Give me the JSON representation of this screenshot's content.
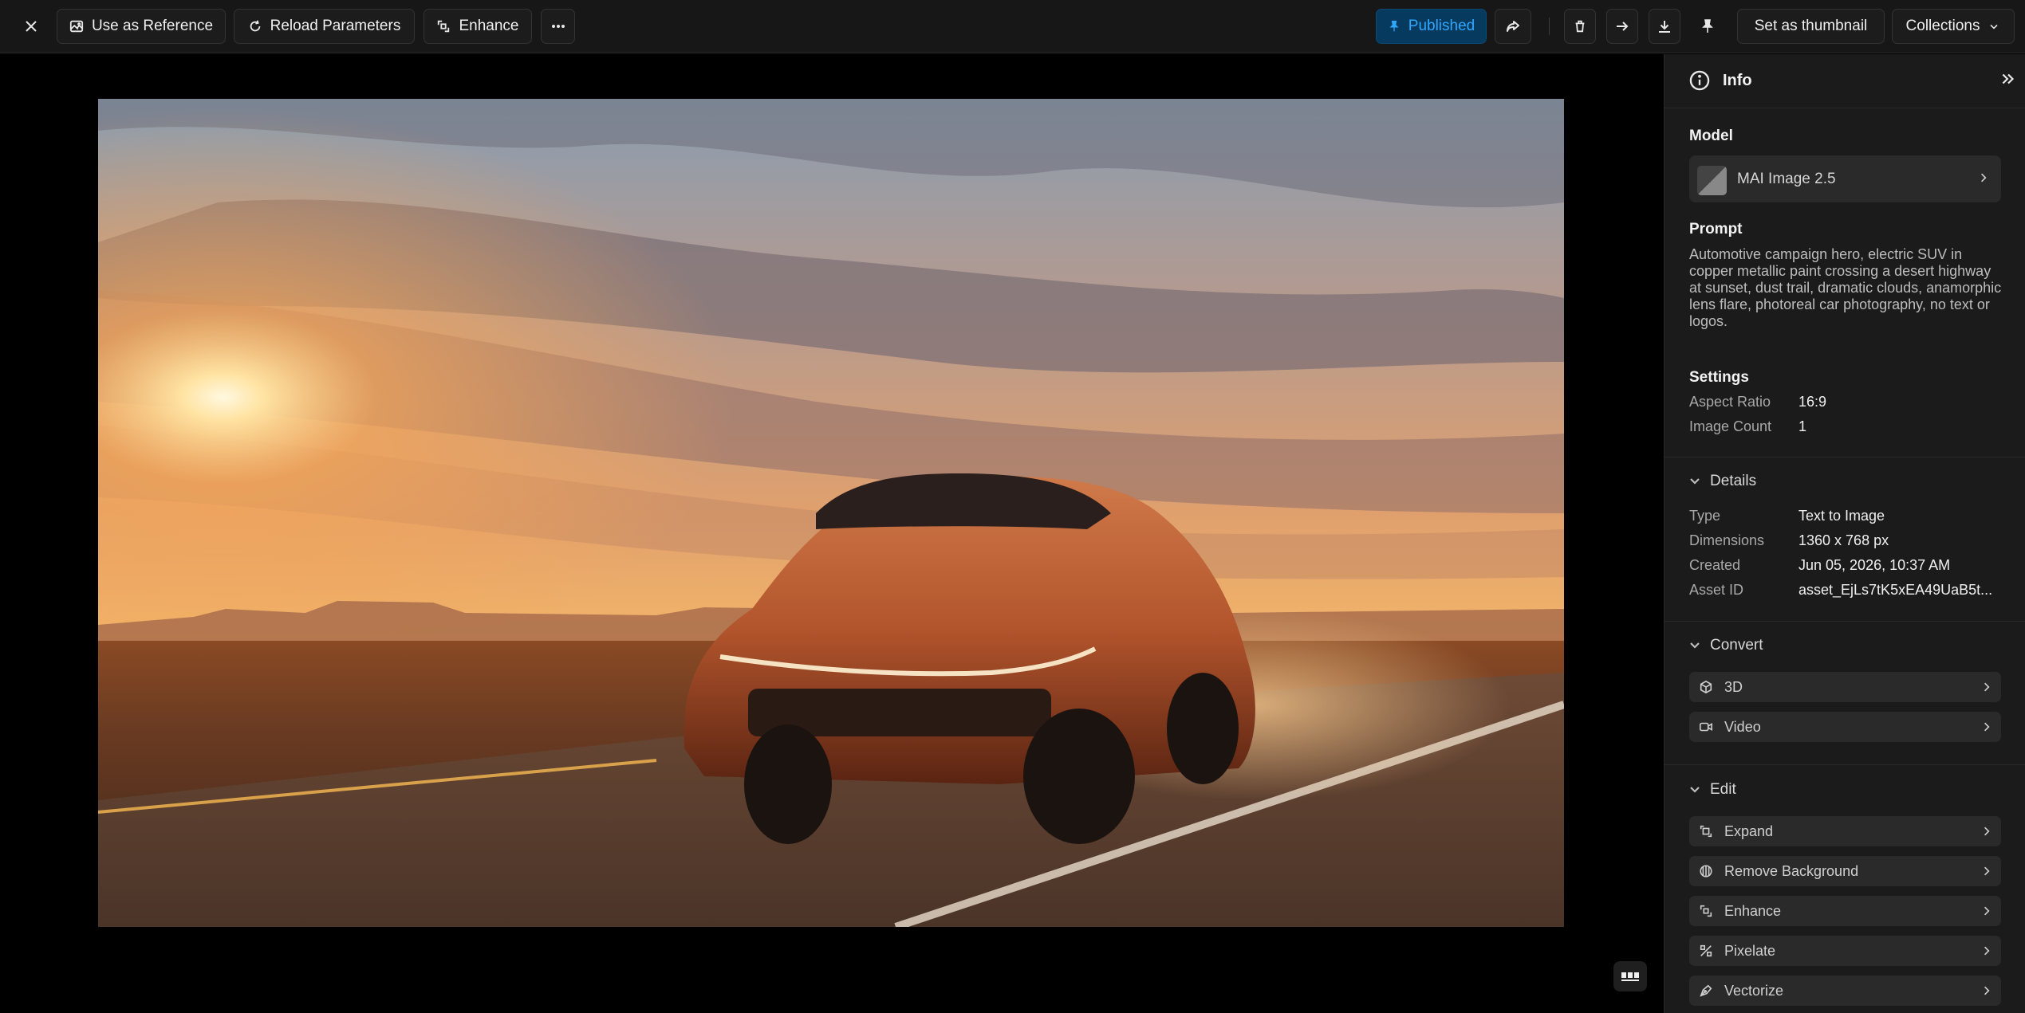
{
  "toolbar": {
    "close_icon": "close-icon",
    "use_as_reference": "Use as Reference",
    "reload_parameters": "Reload Parameters",
    "enhance": "Enhance",
    "more_icon": "more-horizontal-icon",
    "published": "Published",
    "set_as_thumbnail": "Set as thumbnail",
    "collections": "Collections"
  },
  "sidebar": {
    "title": "Info",
    "model_label": "Model",
    "model_name": "MAI Image 2.5",
    "prompt_label": "Prompt",
    "prompt_text": "Automotive campaign hero, electric SUV in copper metallic paint crossing a desert highway at sunset, dust trail, dramatic clouds, anamorphic lens flare, photoreal car photography, no text or logos.",
    "settings_label": "Settings",
    "settings": [
      {
        "key": "Aspect Ratio",
        "value": "16:9"
      },
      {
        "key": "Image Count",
        "value": "1"
      }
    ],
    "details_label": "Details",
    "details": [
      {
        "key": "Type",
        "value": "Text to Image"
      },
      {
        "key": "Dimensions",
        "value": "1360 x 768 px"
      },
      {
        "key": "Created",
        "value": "Jun 05, 2026, 10:37 AM"
      },
      {
        "key": "Asset ID",
        "value": "asset_EjLs7tK5xEA49UaB5t..."
      }
    ],
    "convert_label": "Convert",
    "convert_items": [
      "3D",
      "Video"
    ],
    "edit_label": "Edit",
    "edit_items": [
      "Expand",
      "Remove Background",
      "Enhance",
      "Pixelate",
      "Vectorize"
    ]
  },
  "colors": {
    "accent_published_bg": "#063a5e",
    "accent_published_text": "#2fa7ff",
    "panel_bg": "#1b1b1b",
    "card_bg": "#2a2a2a"
  }
}
